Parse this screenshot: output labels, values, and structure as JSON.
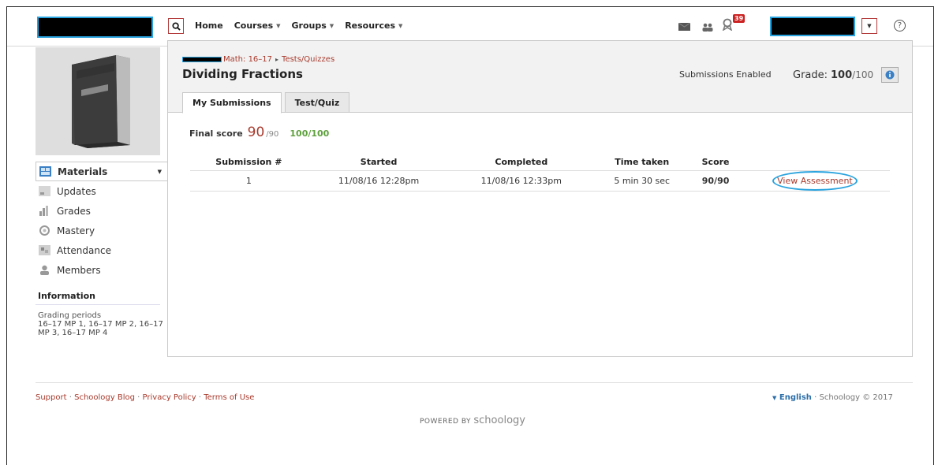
{
  "header": {
    "nav": [
      {
        "label": "Home",
        "has_dropdown": false
      },
      {
        "label": "Courses",
        "has_dropdown": true
      },
      {
        "label": "Groups",
        "has_dropdown": true
      },
      {
        "label": "Resources",
        "has_dropdown": true
      }
    ],
    "notification_count": "39",
    "help_symbol": "?",
    "icons": [
      "search-icon",
      "mail-icon",
      "people-icon",
      "notification-icon",
      "chevron-down-icon",
      "help-icon"
    ]
  },
  "sidebar": {
    "items": [
      {
        "label": "Materials",
        "icon": "materials-icon",
        "active": true
      },
      {
        "label": "Updates",
        "icon": "updates-icon",
        "active": false
      },
      {
        "label": "Grades",
        "icon": "grades-icon",
        "active": false
      },
      {
        "label": "Mastery",
        "icon": "mastery-icon",
        "active": false
      },
      {
        "label": "Attendance",
        "icon": "attendance-icon",
        "active": false
      },
      {
        "label": "Members",
        "icon": "members-icon",
        "active": false
      }
    ],
    "info_title": "Information",
    "grading_label": "Grading periods",
    "grading_periods": "16–17 MP 1, 16–17 MP 2, 16–17 MP 3, 16–17 MP 4"
  },
  "main": {
    "breadcrumb_course": "Math: 16–17",
    "breadcrumb_arrow": "▸",
    "breadcrumb_section": "Tests/Quizzes",
    "title": "Dividing Fractions",
    "submissions_status": "Submissions Enabled",
    "grade_label": "Grade:",
    "grade_value": "100",
    "grade_max": "/100",
    "tabs": [
      {
        "label": "My Submissions",
        "active": true
      },
      {
        "label": "Test/Quiz",
        "active": false
      }
    ],
    "final_score_label": "Final score",
    "final_score_value": "90",
    "final_score_max": "/90",
    "final_score_adjusted": "100/100",
    "table": {
      "headers": [
        "Submission #",
        "Started",
        "Completed",
        "Time taken",
        "Score",
        ""
      ],
      "rows": [
        {
          "num": "1",
          "started": "11/08/16 12:28pm",
          "completed": "11/08/16 12:33pm",
          "time": "5 min 30 sec",
          "score": "90/90",
          "action": "View Assessment"
        }
      ]
    }
  },
  "footer": {
    "links": [
      "Support",
      "Schoology Blog",
      "Privacy Policy",
      "Terms of Use"
    ],
    "separator": "·",
    "language": "English",
    "copyright": "Schoology © 2017",
    "powered_by": "POWERED BY",
    "brand": "schoology"
  },
  "colors": {
    "accent_red": "#a83a2c",
    "link_blue": "#2c6ea8",
    "highlight_blue": "#29a3de",
    "score_green": "#5ea03d",
    "badge_red": "#cc2222"
  }
}
